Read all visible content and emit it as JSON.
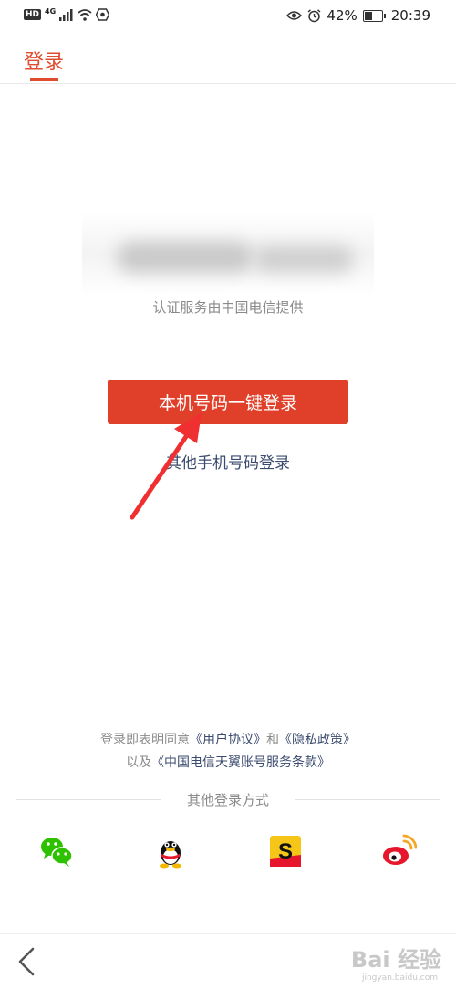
{
  "status_bar": {
    "hd": "HD",
    "network": "4G",
    "battery_percent": "42%",
    "battery_level": 0.42,
    "time": "20:39",
    "icons": [
      "signal-icon",
      "wifi-icon",
      "shield-icon",
      "eye-icon",
      "alarm-icon",
      "battery-icon"
    ]
  },
  "header": {
    "title": "登录"
  },
  "auth": {
    "provider_text": "认证服务由中国电信提供",
    "primary_button": "本机号码一键登录",
    "other_phone_login": "其他手机号码登录"
  },
  "agreement": {
    "line1_prefix": "登录即表明同意",
    "user_agreement": "《用户协议》",
    "and": "和",
    "privacy_policy": "《隐私政策》",
    "line2_prefix": "以及",
    "telecom_terms": "《中国电信天翼账号服务条款》"
  },
  "other_login": {
    "label": "其他登录方式",
    "methods": [
      {
        "icon": "wechat-icon",
        "color": "#2dc100"
      },
      {
        "icon": "qq-icon",
        "color": "#000000"
      },
      {
        "icon": "sogou-icon",
        "color": "#f5c518"
      },
      {
        "icon": "weibo-icon",
        "color": "#e6162d"
      }
    ]
  },
  "watermark": {
    "text": "Bai 经验",
    "sub": "jingyan.baidu.com"
  },
  "colors": {
    "accent": "#e04c2f",
    "button": "#e0402a",
    "link": "#3b4b6e",
    "annotation_arrow": "#f03030"
  }
}
